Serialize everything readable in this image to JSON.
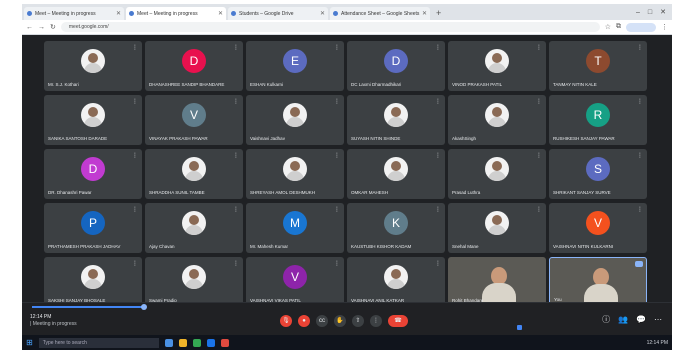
{
  "browser": {
    "tabs": [
      {
        "title": "Meet – Meeting in progress",
        "active": false
      },
      {
        "title": "Meet – Meeting in progress",
        "active": true
      },
      {
        "title": "Students – Google Drive",
        "active": false
      },
      {
        "title": "Attendance Sheet – Google Sheets",
        "active": false
      }
    ],
    "new_tab": "+",
    "url": "meet.google.com/",
    "window_controls": [
      "–",
      "□",
      "✕"
    ]
  },
  "participants": [
    {
      "name": "Mr. S.J. Kothari",
      "type": "photo"
    },
    {
      "name": "DHANASHREE SANDIP BHANDARE",
      "type": "initial",
      "initial": "D",
      "color": "#e8114e"
    },
    {
      "name": "ESHAN Kulkarni",
      "type": "initial",
      "initial": "E",
      "color": "#5c6bc0"
    },
    {
      "name": "DC Laxmi Dharmadhikari",
      "type": "initial",
      "initial": "D",
      "color": "#5c6bc0"
    },
    {
      "name": "VINOD PRAKASH PATIL",
      "type": "photo"
    },
    {
      "name": "TANMAY NITIN KALE",
      "type": "initial",
      "initial": "T",
      "color": "#8d4a2f"
    },
    {
      "name": "SANIKA SANTOSH DARADE",
      "type": "photo"
    },
    {
      "name": "VINAYAK PRAKASH PAWAR",
      "type": "initial",
      "initial": "V",
      "color": "#607d8b"
    },
    {
      "name": "Vaishnavi Jadhav",
      "type": "photo"
    },
    {
      "name": "SUYASH NITIN SHINDE",
      "type": "photo"
    },
    {
      "name": "AkashSingh",
      "type": "photo"
    },
    {
      "name": "RUSHIKESH SANJAY PAWAR",
      "type": "initial",
      "initial": "R",
      "color": "#16a085"
    },
    {
      "name": "DR. Dhanashri Pawar",
      "type": "initial",
      "initial": "D",
      "color": "#c13bd1"
    },
    {
      "name": "SHRADDHA SUNIL TAMBE",
      "type": "photo"
    },
    {
      "name": "SHREYASH AMOL DESHMUKH",
      "type": "photo"
    },
    {
      "name": "OMKAR MAHESH",
      "type": "photo"
    },
    {
      "name": "Prasad Luthra",
      "type": "photo"
    },
    {
      "name": "SHRIKANT SANJAY SURVE",
      "type": "initial",
      "initial": "S",
      "color": "#5c6bc0"
    },
    {
      "name": "PRATHAMESH PRAKASH JADHAV",
      "type": "initial",
      "initial": "P",
      "color": "#1565c0"
    },
    {
      "name": "Ajay Chavan",
      "type": "photo"
    },
    {
      "name": "Mr. Mahesh Kumar",
      "type": "initial",
      "initial": "M",
      "color": "#1976d2"
    },
    {
      "name": "KAUSTUBH KISHOR KADAM",
      "type": "initial",
      "initial": "K",
      "color": "#607d8b"
    },
    {
      "name": "Snehal Mane",
      "type": "photo"
    },
    {
      "name": "VAISHNAVI NITIN KULKARNI",
      "type": "initial",
      "initial": "V",
      "color": "#f4511e"
    },
    {
      "name": "SAKSHI SANJAY BHOSALE",
      "type": "photo"
    },
    {
      "name": "Swami Pradip",
      "type": "photo"
    },
    {
      "name": "VAISHNAVI VIKAS PATIL",
      "type": "initial",
      "initial": "V",
      "color": "#8e24aa"
    },
    {
      "name": "VAISHNAVI ANIL KATKAR",
      "type": "photo"
    },
    {
      "name": "Rohit Bhandare",
      "type": "video"
    },
    {
      "name": "You",
      "type": "self"
    }
  ],
  "bottombar": {
    "meeting_time": "12:14 PM",
    "meeting_code": "| Meeting in progress",
    "controls": [
      {
        "name": "mic-button",
        "glyph": "🎙",
        "style": "red"
      },
      {
        "name": "camera-button",
        "glyph": "●",
        "style": "red"
      },
      {
        "name": "captions-button",
        "glyph": "cc",
        "style": ""
      },
      {
        "name": "raise-hand-button",
        "glyph": "✋",
        "style": ""
      },
      {
        "name": "present-button",
        "glyph": "⇧",
        "style": ""
      },
      {
        "name": "more-options-button",
        "glyph": "⋮",
        "style": ""
      },
      {
        "name": "leave-call-button",
        "glyph": "☎",
        "style": "hang"
      }
    ],
    "right_icons": [
      {
        "name": "info-icon",
        "glyph": "ⓘ"
      },
      {
        "name": "people-icon",
        "glyph": "👥"
      },
      {
        "name": "chat-icon",
        "glyph": "💬"
      },
      {
        "name": "activities-icon",
        "glyph": "⋯"
      }
    ]
  },
  "taskbar": {
    "search_placeholder": "Type here to search",
    "tray_time": "12:14 PM"
  }
}
